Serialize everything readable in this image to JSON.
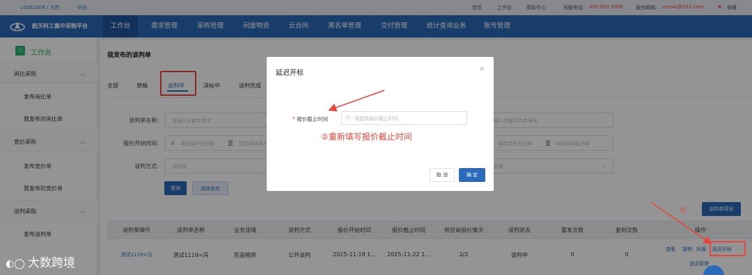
{
  "topbar": {
    "user": "10062008 / 大西",
    "logout": "退出",
    "home": "首页",
    "workbench": "工作台",
    "help": "帮助中心",
    "phone_label": "客服电话:",
    "phone": "400 993 0000",
    "email_label": "服务邮箱:",
    "email": "ecasic@163.com",
    "favorite": "收藏"
  },
  "nav": {
    "platform": "航天科工集中采购平台",
    "items": [
      "工作台",
      "需求管理",
      "采购管理",
      "闲废物资",
      "云合同",
      "黑名单管理",
      "交付管理",
      "统计查询业务",
      "账号管理"
    ]
  },
  "sidebar": {
    "header": "工作台",
    "groups": [
      {
        "label": "询比采购",
        "items": [
          "发布询比单",
          "我发布的询比单"
        ]
      },
      {
        "label": "竞价采购",
        "items": [
          "发布竞价单",
          "我发布的竞价单"
        ]
      },
      {
        "label": "谈判采购",
        "items": [
          "发布谈判单"
        ]
      }
    ]
  },
  "main": {
    "title": "我发布的谈判单",
    "tabs": [
      "全部",
      "草稿",
      "谈判中",
      "决标中",
      "谈判完成"
    ],
    "active_tab": "谈判中",
    "form": {
      "name_label": "谈判单名称:",
      "name_placeholder": "请输入关键字查询",
      "start_label": "报价开始时间:",
      "start_from_placeholder": "请选择开始日期",
      "range_sep": "至",
      "start_to_placeholder": "请选择结束日期",
      "method_label": "谈判方式:",
      "method_placeholder": "请选择",
      "right_no_placeholder": "输入完整谈判单编号",
      "right_from_placeholder": "请选择开始日期",
      "right_to_placeholder": "请选择结束日期",
      "right_select_placeholder": "选择"
    },
    "buttons": {
      "query": "查询",
      "clear": "清除条件",
      "export": "谈判单导出"
    },
    "table": {
      "headers": [
        "谈判单编号",
        "谈判单名称",
        "业务领域",
        "谈判方式",
        "报价开始时间",
        "报价截止时间",
        "供应商报价情况",
        "谈判状态",
        "重发次数",
        "复制次数",
        "操作"
      ],
      "rows": [
        {
          "no": "测试1119=冯",
          "name": "测试1119=冯",
          "domain": "民品物资",
          "method": "公开谈判",
          "start": "2025-11-19 1...",
          "end": "2025-11-22 1...",
          "quotes": "2/2",
          "status": "谈判中",
          "resend": "0",
          "copy": "0",
          "ops": [
            "查看",
            "复制",
            "补报",
            "延迟开标"
          ],
          "ops2": "澄清管理"
        }
      ]
    }
  },
  "modal": {
    "title": "延迟开标",
    "close": "×",
    "required_mark": "*",
    "field_label": "报价截止时间",
    "field_placeholder": "请选择报价截止时间",
    "cancel": "取 消",
    "confirm": "确 定"
  },
  "annotations": {
    "step1": "①",
    "step2": "②重新填写报价截止时间"
  },
  "watermark": "大数跨境",
  "colors": {
    "brand": "#2a6ab8",
    "accent_red": "#e8453c",
    "green": "#2bb673"
  }
}
